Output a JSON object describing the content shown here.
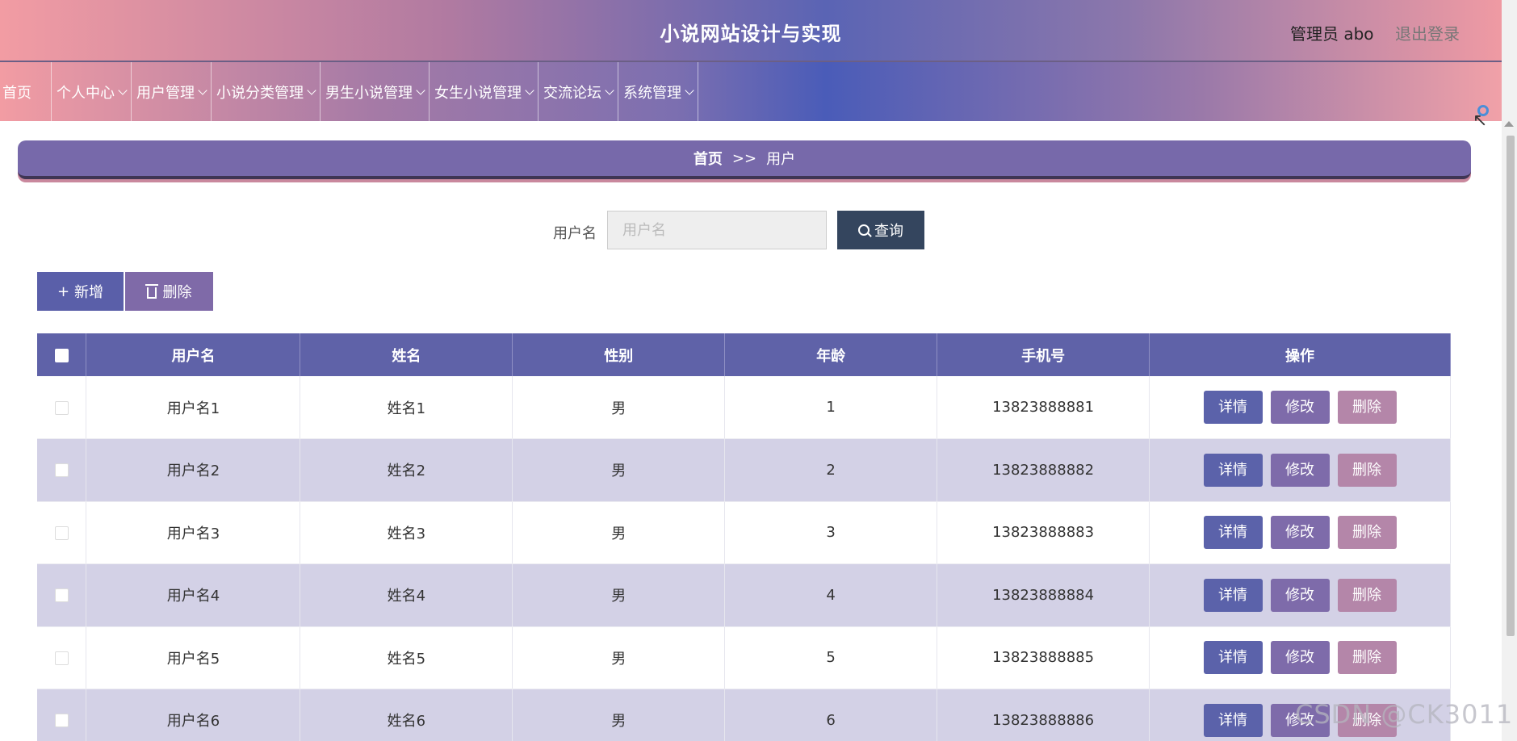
{
  "header": {
    "title": "小说网站设计与实现",
    "admin_label": "管理员 abo",
    "logout_label": "退出登录"
  },
  "nav": {
    "items": [
      {
        "label": "首页",
        "has_dropdown": false
      },
      {
        "label": "个人中心",
        "has_dropdown": true
      },
      {
        "label": "用户管理",
        "has_dropdown": true
      },
      {
        "label": "小说分类管理",
        "has_dropdown": true
      },
      {
        "label": "男生小说管理",
        "has_dropdown": true
      },
      {
        "label": "女生小说管理",
        "has_dropdown": true
      },
      {
        "label": "交流论坛",
        "has_dropdown": true
      },
      {
        "label": "系统管理",
        "has_dropdown": true
      }
    ]
  },
  "breadcrumb": {
    "home": "首页",
    "separator": ">>",
    "current": "用户"
  },
  "search": {
    "label": "用户名",
    "placeholder": "用户名",
    "value": "",
    "button_label": "查询"
  },
  "actions": {
    "add_label": "新增",
    "delete_label": "删除"
  },
  "table": {
    "headers": [
      "用户名",
      "姓名",
      "性别",
      "年龄",
      "手机号",
      "操作"
    ],
    "rows": [
      {
        "username": "用户名1",
        "name": "姓名1",
        "gender": "男",
        "age": "1",
        "phone": "13823888881"
      },
      {
        "username": "用户名2",
        "name": "姓名2",
        "gender": "男",
        "age": "2",
        "phone": "13823888882"
      },
      {
        "username": "用户名3",
        "name": "姓名3",
        "gender": "男",
        "age": "3",
        "phone": "13823888883"
      },
      {
        "username": "用户名4",
        "name": "姓名4",
        "gender": "男",
        "age": "4",
        "phone": "13823888884"
      },
      {
        "username": "用户名5",
        "name": "姓名5",
        "gender": "男",
        "age": "5",
        "phone": "13823888885"
      },
      {
        "username": "用户名6",
        "name": "姓名6",
        "gender": "男",
        "age": "6",
        "phone": "13823888886"
      }
    ],
    "row_actions": {
      "detail": "详情",
      "edit": "修改",
      "delete": "删除"
    }
  },
  "watermark": "CSDN @CK3011",
  "colors": {
    "primary": "#5f62a8",
    "secondary": "#7e6baa",
    "danger": "#b486a9",
    "search_button": "#34455e",
    "row_alt": "#d3d1e6"
  }
}
